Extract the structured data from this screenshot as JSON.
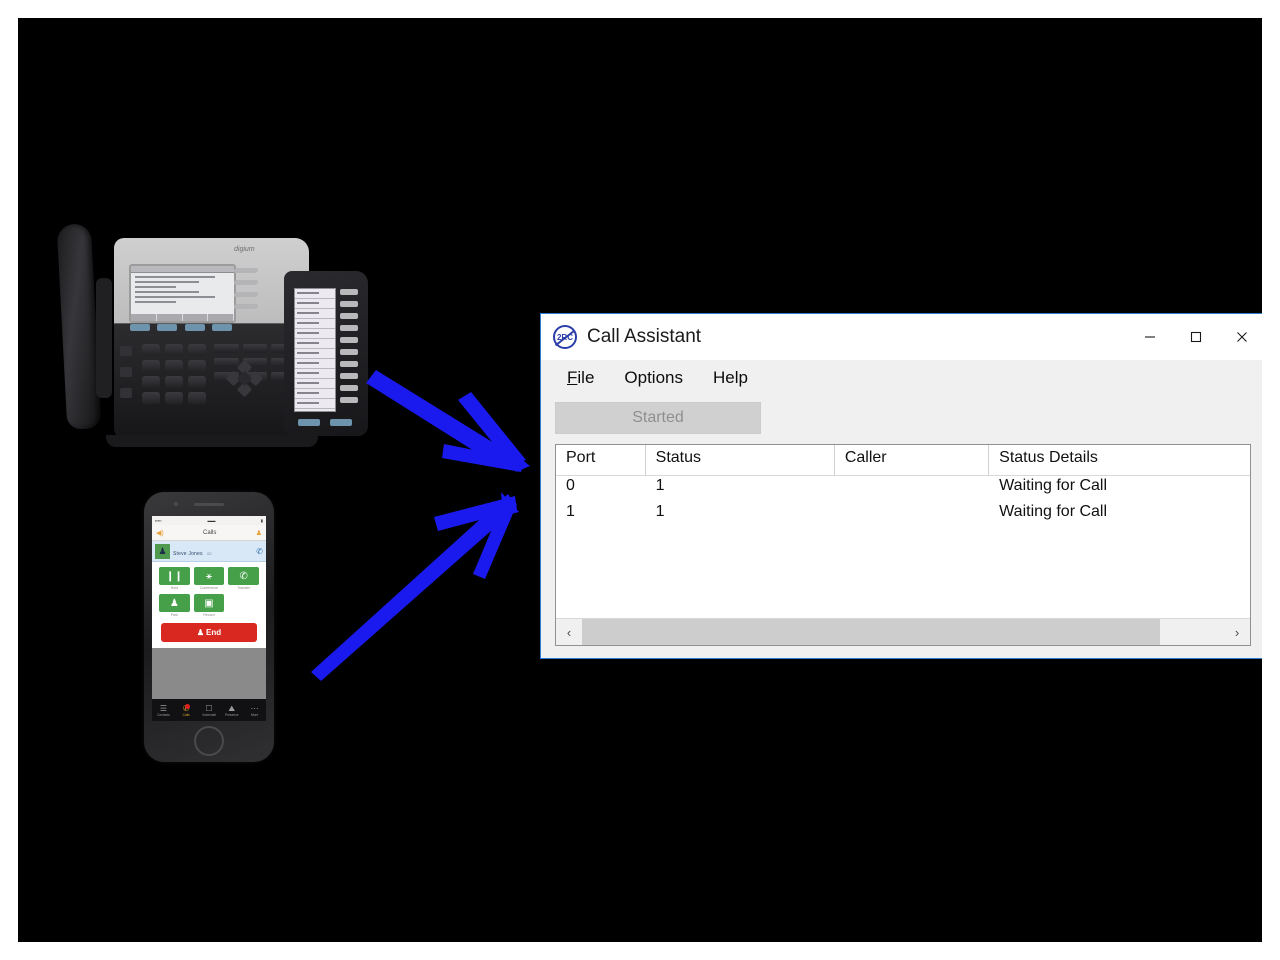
{
  "slide": {
    "background_color": "#000000",
    "accent_arrow_color": "#1a1aee"
  },
  "devices": {
    "desk_phone": {
      "name": "desk-voip-phone",
      "brand_label": "digium",
      "has_sidecar_module": true
    },
    "smartphone": {
      "name": "smartphone-call-app",
      "status_bar": {
        "carrier": "",
        "time": "",
        "battery": ""
      },
      "nav_title": "Calls",
      "contact_name": "Steve Jones",
      "contact_sub": "02",
      "action_buttons": [
        {
          "label": "Hold",
          "icon": "pause-icon"
        },
        {
          "label": "Conference",
          "icon": "conference-icon"
        },
        {
          "label": "Transfer",
          "icon": "transfer-icon"
        },
        {
          "label": "Park",
          "icon": "park-icon"
        },
        {
          "label": "Record",
          "icon": "record-icon"
        }
      ],
      "end_button_label": "End",
      "tabs": [
        {
          "label": "Contacts",
          "icon": "contacts-icon",
          "active": false
        },
        {
          "label": "Calls",
          "icon": "calls-icon",
          "active": true
        },
        {
          "label": "Voicemail",
          "icon": "voicemail-icon",
          "active": false
        },
        {
          "label": "Presence",
          "icon": "presence-icon",
          "active": false
        },
        {
          "label": "More",
          "icon": "more-icon",
          "active": false
        }
      ]
    }
  },
  "window": {
    "title": "Call Assistant",
    "icon_label": "2RC",
    "controls": {
      "minimize": "—",
      "maximize": "☐",
      "close": "✕"
    },
    "menu": [
      {
        "accel": "F",
        "rest": "ile"
      },
      {
        "accel": "",
        "rest": "Options"
      },
      {
        "accel": "",
        "rest": "Help"
      }
    ],
    "toolbar": {
      "status_button_label": "Started",
      "status_button_enabled": false
    },
    "list": {
      "columns": [
        "Port",
        "Status",
        "Caller",
        "Status Details"
      ],
      "rows": [
        {
          "port": "0",
          "status": "1",
          "caller": "",
          "details": "Waiting for Call"
        },
        {
          "port": "1",
          "status": "1",
          "caller": "",
          "details": "Waiting for Call"
        }
      ]
    },
    "scrollbar": {
      "left_arrow": "‹",
      "right_arrow": "›"
    }
  }
}
